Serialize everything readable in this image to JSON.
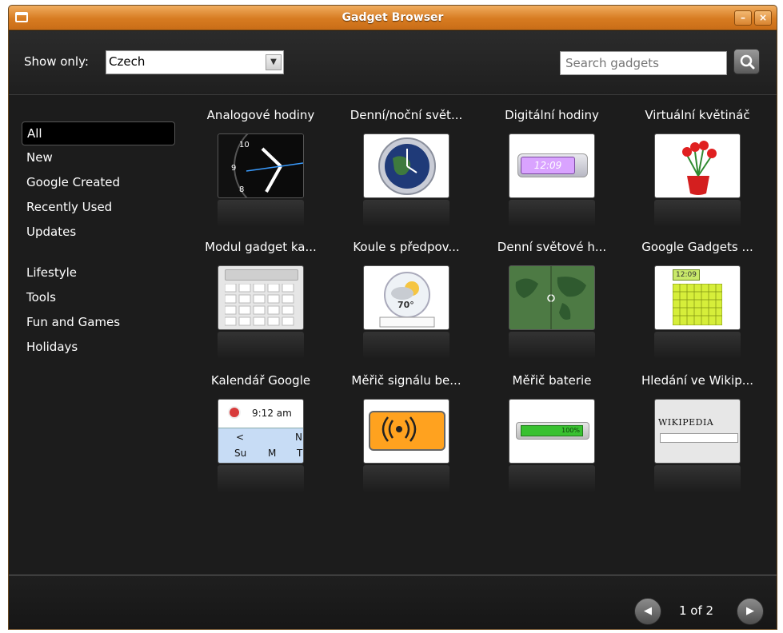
{
  "window": {
    "title": "Gadget Browser"
  },
  "filter": {
    "label": "Show only:",
    "selected": "Czech"
  },
  "search": {
    "placeholder": "Search gadgets"
  },
  "sidebar": {
    "items": [
      "All",
      "New",
      "Google Created",
      "Recently Used",
      "Updates",
      "Lifestyle",
      "Tools",
      "Fun and Games",
      "Holidays"
    ]
  },
  "gadgets": [
    {
      "name": "Analogové hodiny",
      "icon": "analog-clock-icon"
    },
    {
      "name": "Denní/noční svět...",
      "icon": "day-night-globe-icon"
    },
    {
      "name": "Digitální hodiny",
      "icon": "digital-clock-icon"
    },
    {
      "name": "Virtuální květináč",
      "icon": "flower-pot-icon"
    },
    {
      "name": "Modul gadget ka...",
      "icon": "calculator-icon"
    },
    {
      "name": "Koule s předpov...",
      "icon": "weather-globe-icon"
    },
    {
      "name": "Denní světové h...",
      "icon": "world-map-icon"
    },
    {
      "name": "Google Gadgets ...",
      "icon": "calendar-clock-icon"
    },
    {
      "name": "Kalendář Google",
      "icon": "google-calendar-icon"
    },
    {
      "name": "Měřič signálu be...",
      "icon": "wireless-signal-icon"
    },
    {
      "name": "Měřič baterie",
      "icon": "battery-meter-icon"
    },
    {
      "name": "Hledání ve Wikip...",
      "icon": "wikipedia-search-icon"
    }
  ],
  "thumb_text": {
    "digital_time": "12:09",
    "weather_temp": "70°",
    "calendar_time": "9:12 am",
    "calendar_prev": "<",
    "calendar_next": "N",
    "calendar_days": [
      "Su",
      "M",
      "T"
    ],
    "battery_pct": "100%",
    "wiki_logo": "WIKIPEDIA"
  },
  "pagination": {
    "text": "1 of 2"
  },
  "colors": {
    "titlebar": "#d77b21",
    "background": "#1c1c1c",
    "text": "#ffffff"
  }
}
